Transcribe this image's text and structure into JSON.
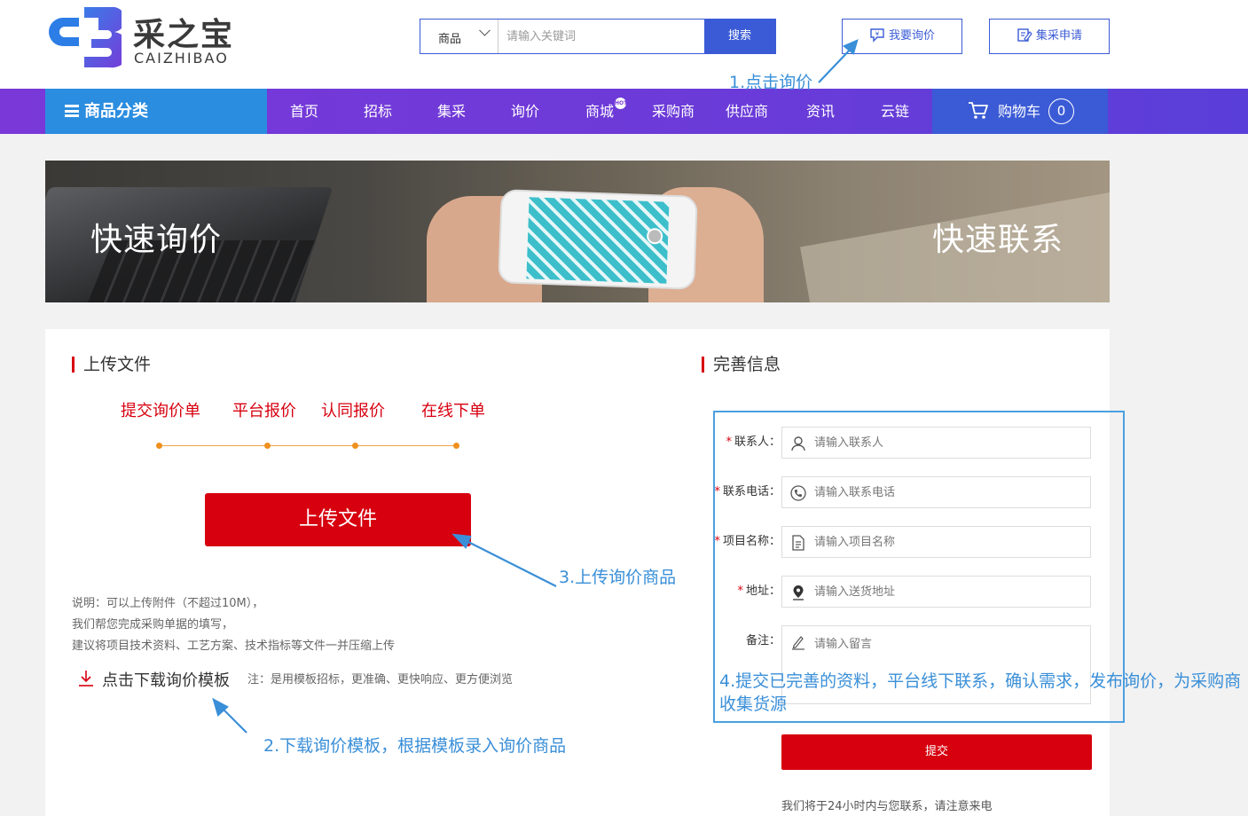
{
  "header": {
    "logo_cn": "采之宝",
    "logo_en": "CAIZHIBAO",
    "search": {
      "category": "商品",
      "placeholder": "请输入关键词",
      "button": "搜索"
    },
    "inquiry_button": "我要询价",
    "apply_button": "集采申请"
  },
  "nav": {
    "category": "商品分类",
    "items": [
      "首页",
      "招标",
      "集采",
      "询价",
      "商城",
      "采购商",
      "供应商",
      "资讯",
      "云链"
    ],
    "hot_badge": "HOT",
    "cart_label": "购物车",
    "cart_count": "0"
  },
  "banner": {
    "left_text": "快速询价",
    "right_text": "快速联系"
  },
  "upload": {
    "title": "上传文件",
    "steps": [
      "提交询价单",
      "平台报价",
      "认同报价",
      "在线下单"
    ],
    "button": "上传文件",
    "desc": [
      "说明：可以上传附件（不超过10M），",
      "我们帮您完成采购单据的填写，",
      "建议将项目技术资料、工艺方案、技术指标等文件一并压缩上传"
    ],
    "download": "点击下载询价模板",
    "note": "注：是用模板招标，更准确、更快响应、更方便浏览"
  },
  "info": {
    "title": "完善信息",
    "fields": [
      {
        "label": "联系人：",
        "required": "*",
        "placeholder": "请输入联系人",
        "icon": "person-icon"
      },
      {
        "label": "联系电话：",
        "required": "*",
        "placeholder": "请输入联系电话",
        "icon": "phone-icon"
      },
      {
        "label": "项目名称：",
        "required": "*",
        "placeholder": "请输入项目名称",
        "icon": "document-icon"
      },
      {
        "label": "地址：",
        "required": "*",
        "placeholder": "请输入送货地址",
        "icon": "location-pin-icon"
      },
      {
        "label": "备注：",
        "required": "",
        "placeholder": "请输入留言",
        "icon": "pen-icon"
      }
    ],
    "submit": "提交",
    "contact_note": "我们将于24小时内与您联系，请注意来电"
  },
  "annotations": {
    "a1": "1.点击询价",
    "a2": "2.下载询价模板，根据模板录入询价商品",
    "a3": "3.上传询价商品",
    "a4_line1": "4.提交已完善的资料，平台线下联系，确认需求，发布询价，为采购商",
    "a4_line2": "收集货源"
  },
  "colors": {
    "brand_blue": "#3b5bd6",
    "nav_purple": "#7a38d8",
    "accent_red": "#d7000f",
    "annotation_blue": "#3a8fd8"
  }
}
